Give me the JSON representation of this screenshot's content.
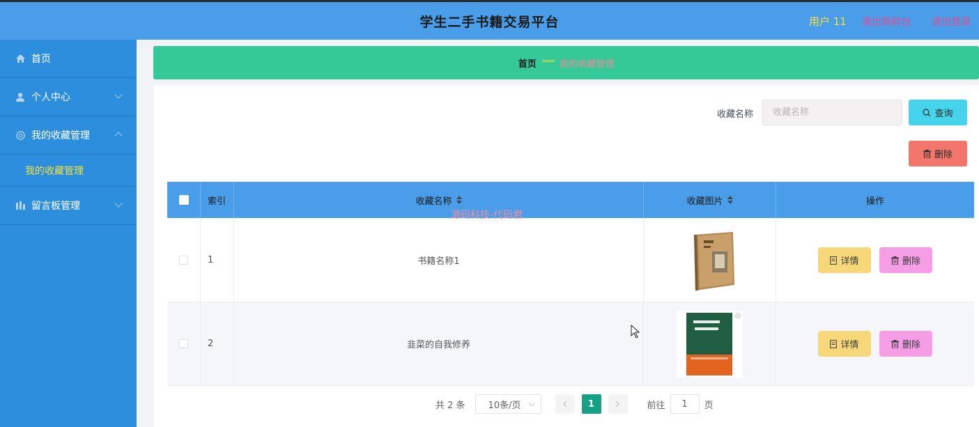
{
  "header": {
    "title": "学生二手书籍交易平台",
    "user": "用户 11",
    "link_back": "退出到前台",
    "link_logout": "退出登录"
  },
  "sidebar": {
    "items": [
      {
        "label": "首页",
        "icon": "home-icon"
      },
      {
        "label": "个人中心",
        "icon": "user-icon"
      },
      {
        "label": "我的收藏管理",
        "icon": "collection-icon"
      },
      {
        "label": "留言板管理",
        "icon": "message-board-icon"
      }
    ],
    "sub_item": "我的收藏管理"
  },
  "breadcrumb": {
    "home": "首页",
    "separator": "*****",
    "current": "我的收藏管理"
  },
  "search": {
    "label": "收藏名称",
    "placeholder": "收藏名称",
    "query_button": "查询",
    "delete_button": "删除"
  },
  "table": {
    "columns": [
      "索引",
      "收藏名称",
      "收藏图片",
      "操作"
    ],
    "rows": [
      {
        "index": "1",
        "name": "书籍名称1"
      },
      {
        "index": "2",
        "name": "韭菜的自我修养"
      }
    ],
    "detail_label": "详情",
    "delete_label": "删除"
  },
  "watermark": "源码科技-代码君",
  "pagination": {
    "total": "共 2 条",
    "page_size": "10条/页",
    "current_page": "1",
    "goto_label": "前往",
    "goto_value": "1",
    "page_suffix": "页"
  },
  "colors": {
    "header_bg": "#4a9de9",
    "sidebar_bg": "#2e8ede",
    "breadcrumb_bg": "#34c997",
    "query_button": "#46d4ec",
    "delete_button": "#f2766b",
    "detail_button": "#f6d87a",
    "row_delete_button": "#f59ee6",
    "active_page": "#16a085"
  }
}
